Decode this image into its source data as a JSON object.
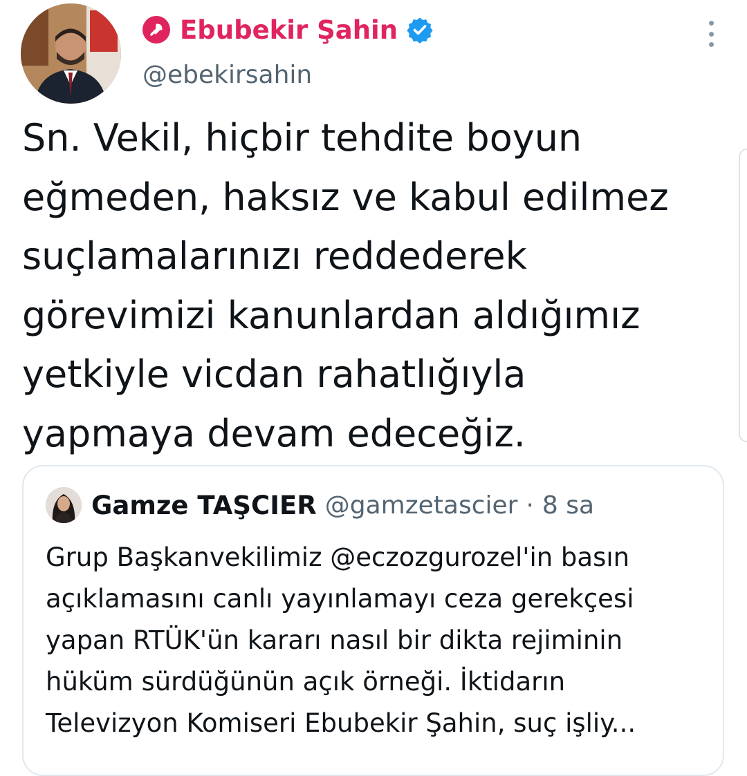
{
  "author": {
    "display_name": "Ebubekir Şahin",
    "handle": "@ebekirsahin"
  },
  "tweet": {
    "lines": [
      "Sn. Vekil, hiçbir tehdite boyun",
      "eğmeden, haksız ve kabul edilmez",
      "suçlamalarınızı reddederek",
      "görevimizi kanunlardan aldığımız",
      "yetkiyle vicdan rahatlığıyla",
      "yapmaya devam edeceğiz."
    ]
  },
  "quoted_tweet": {
    "display_name": "Gamze TAŞCIER",
    "handle": "@gamzetascier",
    "separator": "·",
    "time": "8 sa",
    "lines": [
      "Grup Başkanvekilimiz @eczozgurozel'in basın",
      "açıklamasını canlı yayınlamayı ceza gerekçesi",
      "yapan RTÜK'ün kararı nasıl bir dikta rejiminin",
      "hüküm sürdüğünün açık örneği. İktidarın",
      "Televizyon Komiseri Ebubekir Şahin, suç işliy..."
    ]
  },
  "colors": {
    "government_badge": "#e0245e",
    "verified": "#1d9bf0",
    "secondary_text": "#536471",
    "border": "#e1e8ed"
  },
  "icons": {
    "badge": "government-affiliated-badge-icon",
    "verified": "verified-check-icon",
    "more": "more-options-icon"
  }
}
